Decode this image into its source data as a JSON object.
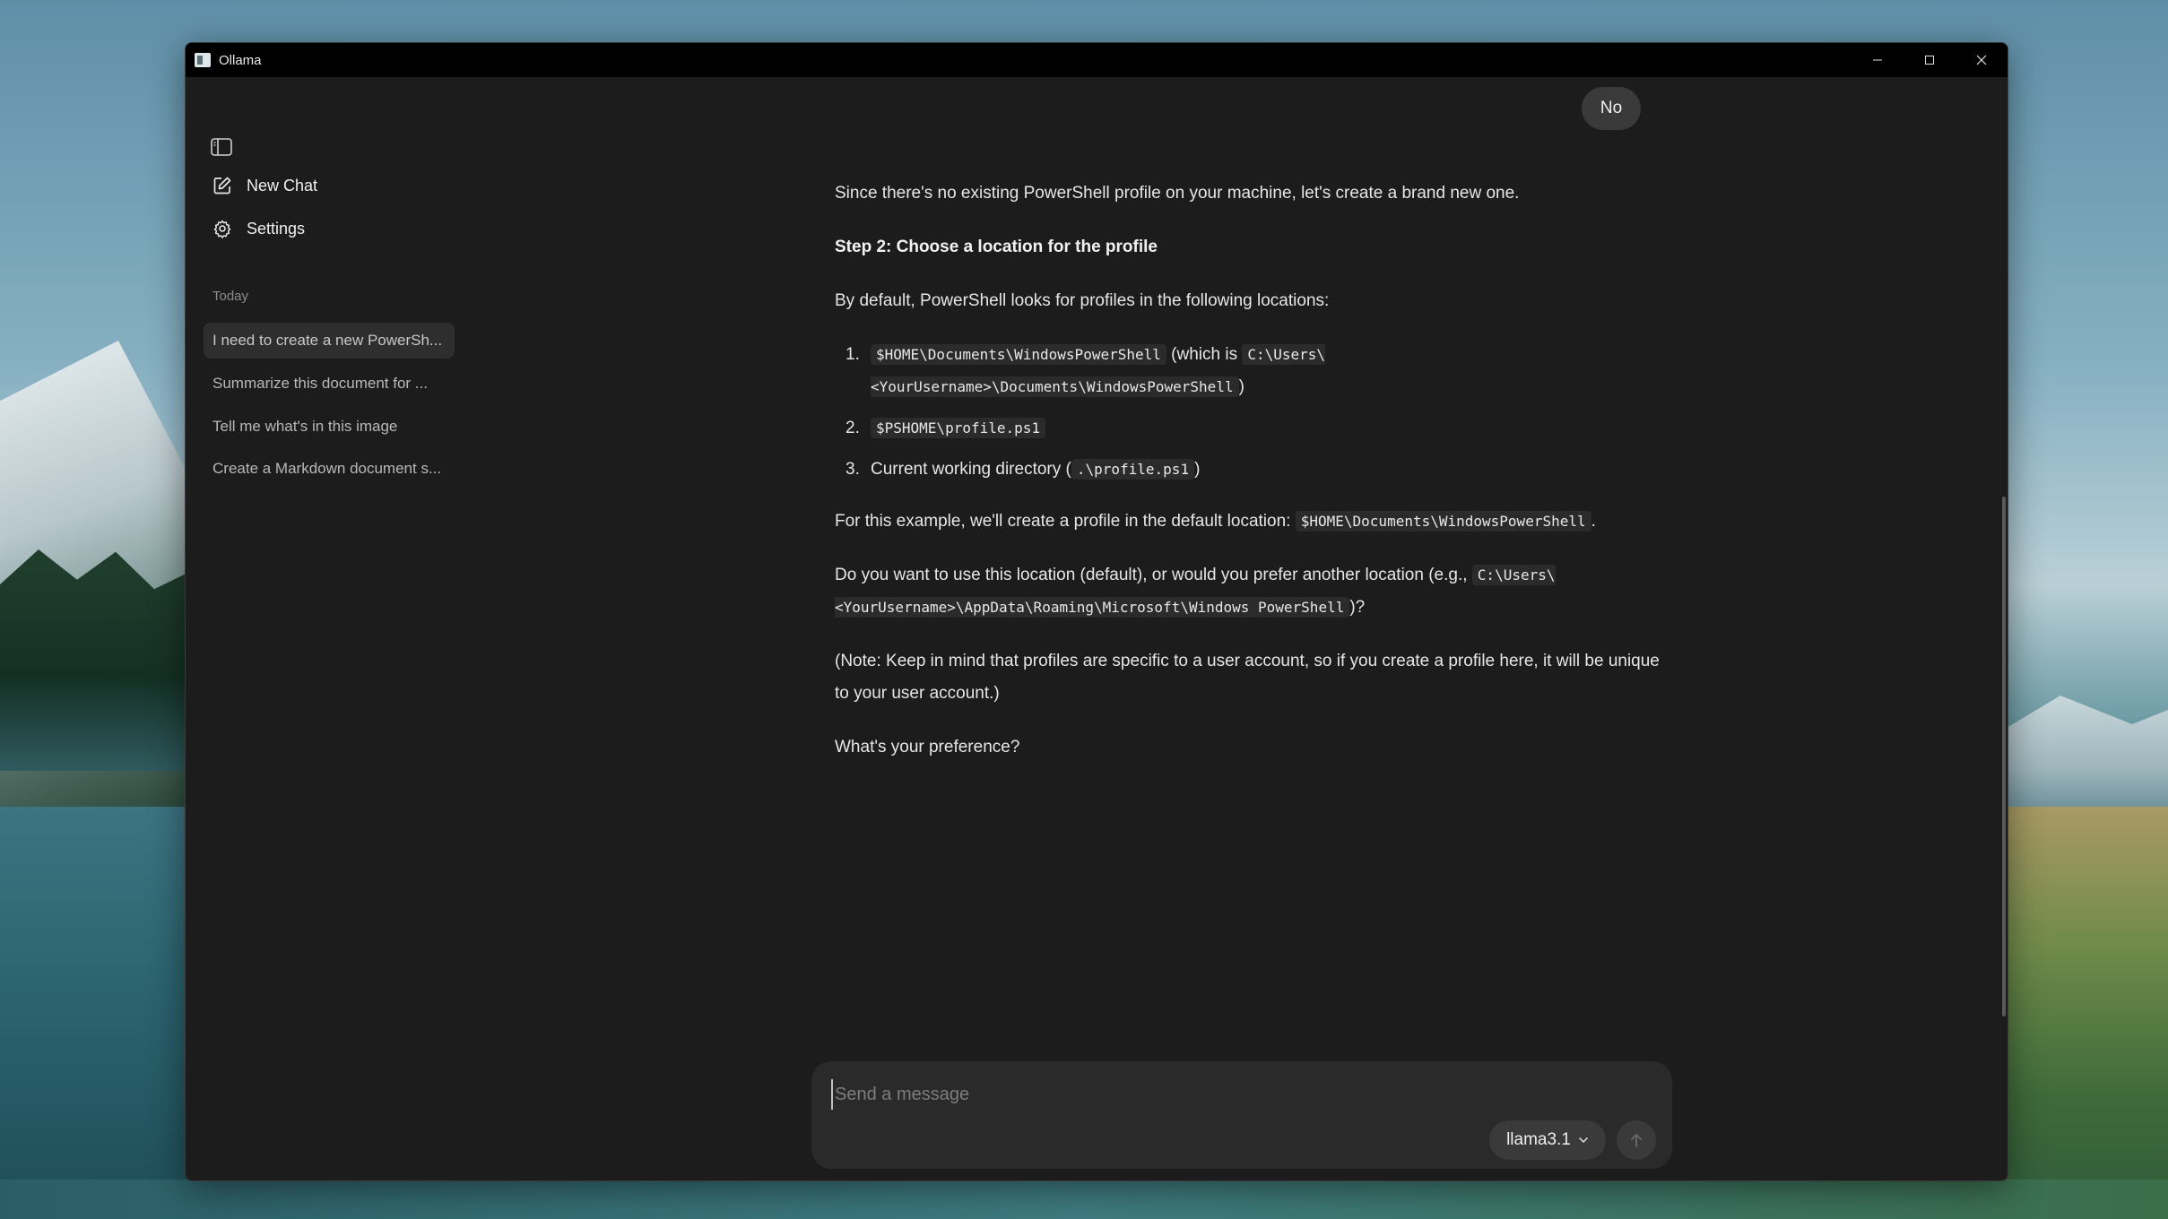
{
  "window": {
    "title": "Ollama"
  },
  "sidebar": {
    "nav": {
      "new_chat": "New Chat",
      "settings": "Settings"
    },
    "section_label": "Today",
    "history": [
      "I need to create a new PowerSh...",
      "Summarize this document for ...",
      "Tell me what's in this image",
      "Create a Markdown document s..."
    ]
  },
  "chat": {
    "user_message": "No",
    "assistant": {
      "p1": "Since there's no existing PowerShell profile on your machine, let's create a brand new one.",
      "heading": "Step 2: Choose a location for the profile",
      "p2": "By default, PowerShell looks for profiles in the following locations:",
      "list": [
        {
          "num": "1.",
          "code1": "$HOME\\Documents\\WindowsPowerShell",
          "text_mid": " (which is ",
          "code2": "C:\\Users\\<YourUsername>\\Documents\\WindowsPowerShell",
          "text_end": ")"
        },
        {
          "num": "2.",
          "code1": "$PSHOME\\profile.ps1"
        },
        {
          "num": "3.",
          "text_start": "Current working directory (",
          "code1": ".\\profile.ps1",
          "text_end": ")"
        }
      ],
      "p3_text": "For this example, we'll create a profile in the default location: ",
      "p3_code": "$HOME\\Documents\\WindowsPowerShell",
      "p3_end": ".",
      "p4_text": "Do you want to use this location (default), or would you prefer another location (e.g., ",
      "p4_code": "C:\\Users\\<YourUsername>\\AppData\\Roaming\\Microsoft\\Windows PowerShell",
      "p4_end": ")?",
      "p5": "(Note: Keep in mind that profiles are specific to a user account, so if you create a profile here, it will be unique to your user account.)",
      "p6": "What's your preference?"
    }
  },
  "composer": {
    "placeholder": "Send a message",
    "model": "llama3.1"
  },
  "icons": {
    "sidebar_toggle": "sidebar-toggle-icon",
    "new_chat": "edit-icon",
    "settings": "gear-icon",
    "model_dropdown": "chevron-down-icon",
    "send": "arrow-up-icon"
  }
}
